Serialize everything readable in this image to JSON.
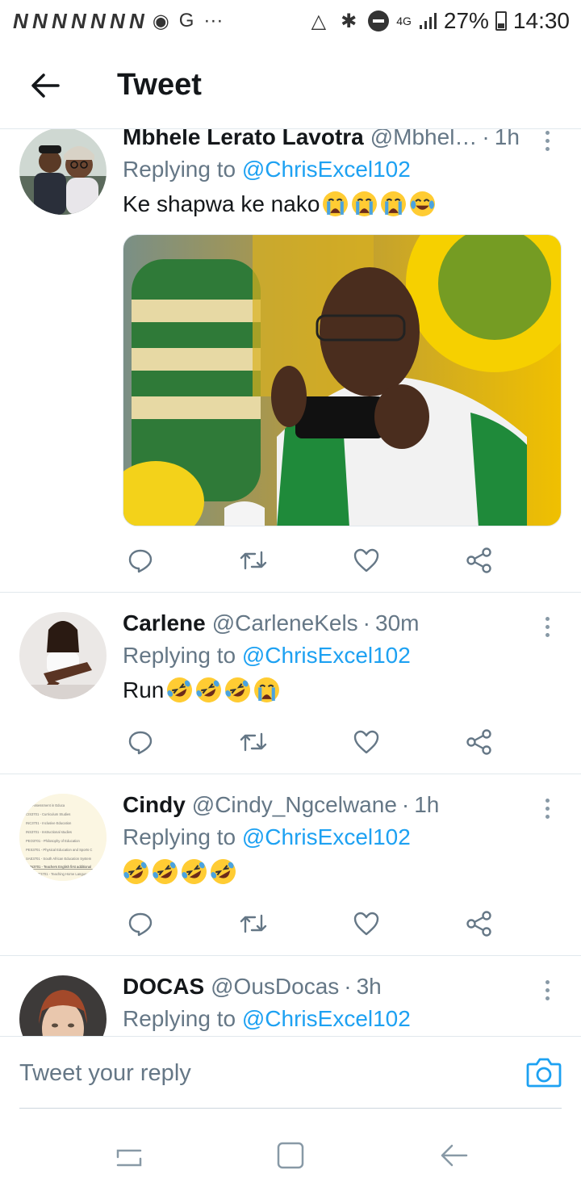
{
  "status_bar": {
    "carrier_marks": "N N N N N N N",
    "g_label": "G",
    "more": "···",
    "network": "4G",
    "battery": "27%",
    "time": "14:30"
  },
  "header": {
    "title": "Tweet"
  },
  "tweets": [
    {
      "name": "Mbhele Lerato Lavotra",
      "handle": "@Mbhel…",
      "time": "1h",
      "replying_prefix": "Replying to",
      "replying_to": "@ChrisExcel102",
      "text": "Ke shapwa ke nako",
      "emojis": [
        "crying",
        "crying",
        "crying",
        "tears-of-joy"
      ],
      "has_media": true
    },
    {
      "name": "Carlene",
      "handle": "@CarleneKels",
      "time": "30m",
      "replying_prefix": "Replying to",
      "replying_to": "@ChrisExcel102",
      "text": "Run",
      "emojis": [
        "rolling-laughing",
        "rolling-laughing",
        "rolling-laughing",
        "crying"
      ]
    },
    {
      "name": "Cindy",
      "handle": "@Cindy_Ngcelwane",
      "time": "1h",
      "replying_prefix": "Replying to",
      "replying_to": "@ChrisExcel102",
      "text": "",
      "emojis": [
        "rolling-laughing",
        "rolling-laughing",
        "rolling-laughing",
        "rolling-laughing"
      ]
    },
    {
      "name": "DOCAS",
      "handle": "@OusDocas",
      "time": "3h",
      "replying_prefix": "Replying to",
      "replying_to": "@ChrisExcel102"
    }
  ],
  "cindy_avatar_lines": [
    "Assessment in Educa",
    "CIS3701 - Curriculum Studies",
    "INC3701 - Inclusive Education",
    "INS3701 - Instructional studies",
    "PEO3701 - Philosophy of Education",
    "PES3701 - Physical Education and Sports C",
    "SAE3701 - South African Education System",
    "TMN3701 - Teachers English first additional",
    "TTR3701 - Teaching Home Language"
  ],
  "composer": {
    "placeholder": "Tweet your reply"
  },
  "colors": {
    "accent": "#1da1f2",
    "text": "#14171a",
    "muted": "#657786",
    "divider": "#e1e8ed"
  }
}
